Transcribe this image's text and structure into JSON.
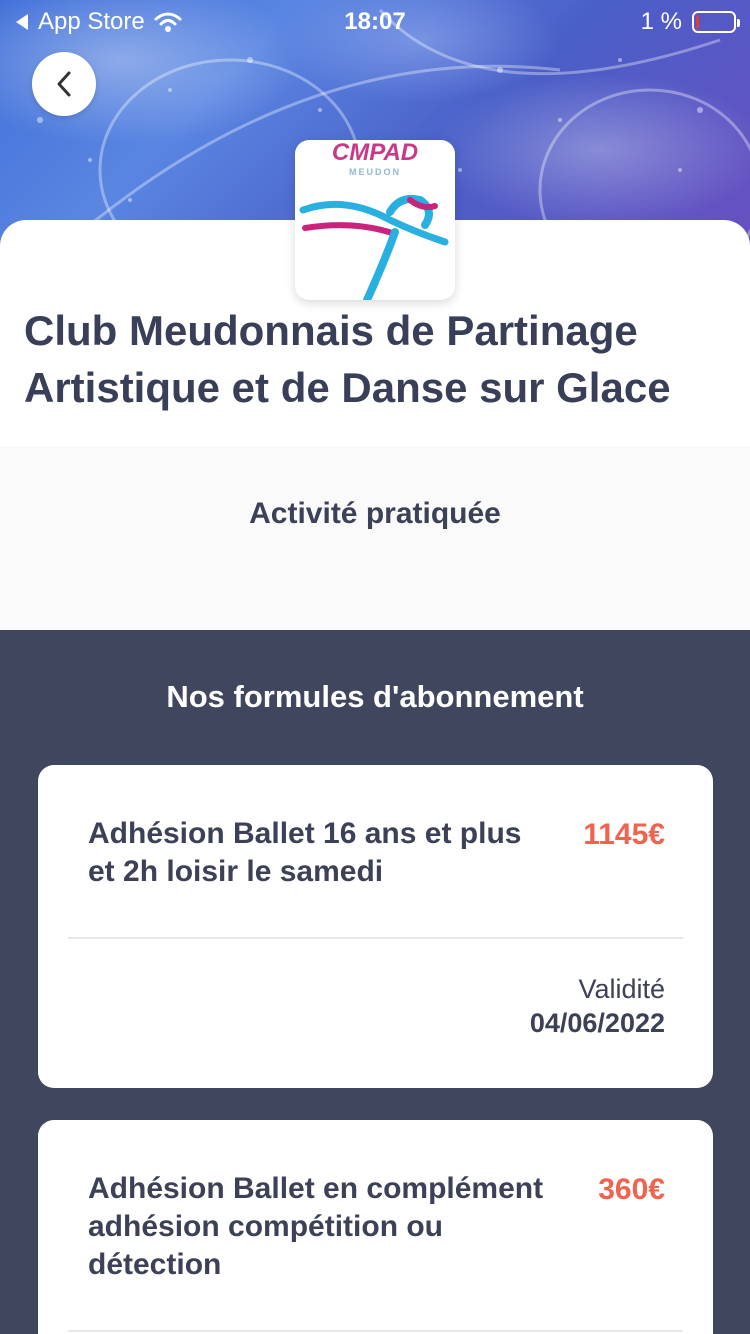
{
  "status_bar": {
    "back_app": "App Store",
    "time": "18:07",
    "battery": "1 %",
    "battery_level": 0.01
  },
  "icons": {
    "back": "chevron-left-icon",
    "wifi": "wifi-icon",
    "battery": "battery-icon"
  },
  "club": {
    "logo_text": "CMPAD",
    "logo_subtext": "MEUDON",
    "title_line1": "Club Meudonnais de Partinage",
    "title_line2": "Artistique et de Danse sur Glace"
  },
  "activity": {
    "label": "Activité pratiquée"
  },
  "formulas": {
    "title": "Nos formules d'abonnement",
    "items": [
      {
        "name_line1": "Adhésion Ballet 16 ans et plus",
        "name_line2": "et 2h loisir le samedi",
        "price": "1145€",
        "validity_label": "Validité",
        "validity_date": "04/06/2022"
      },
      {
        "name_line1": "Adhésion Ballet en complément",
        "name_line2": "adhésion compétition ou",
        "name_line3": "détection",
        "price": "360€"
      }
    ]
  },
  "colors": {
    "dark_bg": "#41465f",
    "title_text": "#393e59",
    "price": "#f0634f",
    "hero_blue": "#4a6fd8"
  }
}
